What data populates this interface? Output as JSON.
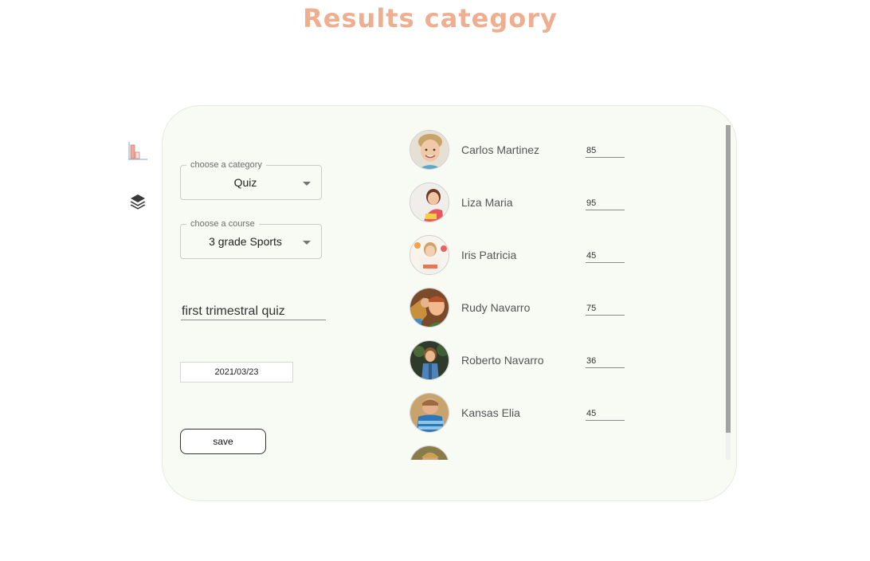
{
  "page": {
    "title": "Results category"
  },
  "rail": {
    "icons": [
      "bar-chart-icon",
      "layers-icon"
    ]
  },
  "form": {
    "category": {
      "legend": "choose a category",
      "value": "Quiz"
    },
    "course": {
      "legend": "choose a course",
      "value": "3 grade Sports"
    },
    "quiz_name": "first trimestral quiz",
    "date": "2021/03/23",
    "save_label": "save"
  },
  "students": [
    {
      "name": "Carlos Martinez",
      "score": "85"
    },
    {
      "name": "Liza Maria",
      "score": "95"
    },
    {
      "name": "Iris Patricia",
      "score": "45"
    },
    {
      "name": "Rudy Navarro",
      "score": "75"
    },
    {
      "name": "Roberto Navarro",
      "score": "36"
    },
    {
      "name": "Kansas Elia",
      "score": "45"
    },
    {
      "name": "",
      "score": ""
    }
  ],
  "colors": {
    "title": "#eeae8f",
    "card_background": "#f8faf4",
    "chart_icon_bars": "#f0a79a",
    "chart_icon_axis": "#9ab8d8"
  }
}
